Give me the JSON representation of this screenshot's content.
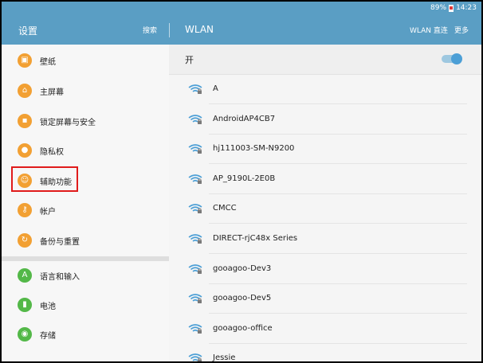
{
  "status_bar": {
    "battery": "89%",
    "time": "14:23"
  },
  "action_bar": {
    "settings_title": "设置",
    "search_label": "搜索",
    "wlan_title": "WLAN",
    "wlan_direct_label": "WLAN 直连",
    "more_label": "更多"
  },
  "left_menu": {
    "items": [
      {
        "label": "壁纸",
        "icon": "wallpaper-icon"
      },
      {
        "label": "主屏幕",
        "icon": "home-icon"
      },
      {
        "label": "锁定屏幕与安全",
        "icon": "lock-icon"
      },
      {
        "label": "隐私权",
        "icon": "privacy-icon"
      },
      {
        "label": "辅助功能",
        "icon": "accessibility-icon"
      },
      {
        "label": "帐户",
        "icon": "key-icon"
      },
      {
        "label": "备份与重置",
        "icon": "backup-icon"
      },
      {
        "label": "语言和输入",
        "icon": "language-icon"
      },
      {
        "label": "电池",
        "icon": "battery-icon"
      },
      {
        "label": "存储",
        "icon": "storage-icon"
      }
    ]
  },
  "wlan": {
    "toggle_label": "开",
    "toggle_on": true,
    "networks": [
      "A",
      "AndroidAP4CB7",
      "hj111003-SM-N9200",
      "AP_9190L-2E0B",
      "CMCC",
      "DIRECT-rjC48x Series",
      "gooagoo-Dev3",
      "gooagoo-Dev5",
      "gooagoo-office",
      "Jessie"
    ]
  },
  "colors": {
    "accent": "#5a9ec4",
    "orange_icon": "#f2a033",
    "green_icon": "#53b848",
    "highlight": "#e01b1b",
    "toggle": "#4c9fd6"
  }
}
